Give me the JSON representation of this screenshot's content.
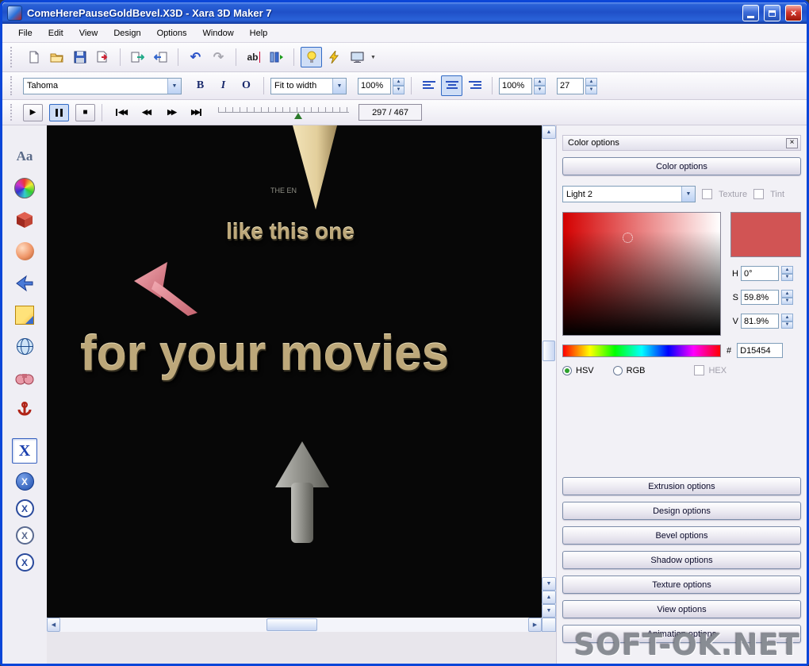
{
  "window": {
    "title": "ComeHerePauseGoldBevel.X3D - Xara 3D Maker 7"
  },
  "menu": {
    "items": [
      "File",
      "Edit",
      "View",
      "Design",
      "Options",
      "Window",
      "Help"
    ]
  },
  "format_toolbar": {
    "font_name": "Tahoma",
    "bold": "B",
    "italic": "I",
    "outline": "O",
    "fit_mode": "Fit to width",
    "zoom_value": "100%",
    "scale_value": "100%",
    "size_value": "27"
  },
  "playback": {
    "frame_counter": "297 / 467"
  },
  "canvas": {
    "text_small": "THE EN",
    "text_mid": "like this one",
    "text_large": "for your movies"
  },
  "color_panel": {
    "title": "Color options",
    "apply_button": "Color options",
    "light_selected": "Light 2",
    "texture_checkbox": "Texture",
    "tint_checkbox": "Tint",
    "h": {
      "label": "H",
      "value": "0°"
    },
    "s": {
      "label": "S",
      "value": "59.8%"
    },
    "v": {
      "label": "V",
      "value": "81.9%"
    },
    "hex": {
      "label": "#",
      "value": "D15454"
    },
    "hsv_radio": "HSV",
    "rgb_radio": "RGB",
    "hex_checkbox": "HEX",
    "swatch_color": "#d15454",
    "option_buttons": [
      "Extrusion options",
      "Design options",
      "Bevel options",
      "Shadow options",
      "Texture options",
      "View options",
      "Animation options"
    ]
  },
  "watermark": "SOFT-OK.NET",
  "icons": {
    "close": "×",
    "up": "▲",
    "down": "▼",
    "left": "◀",
    "right": "▶",
    "undo": "↶",
    "redo": "↷",
    "play": "▶",
    "stop": "■",
    "rew": "◀◀",
    "fwd": "▶▶",
    "text_tool": "ab",
    "sidebar_text": "Aa",
    "xara": "X"
  }
}
